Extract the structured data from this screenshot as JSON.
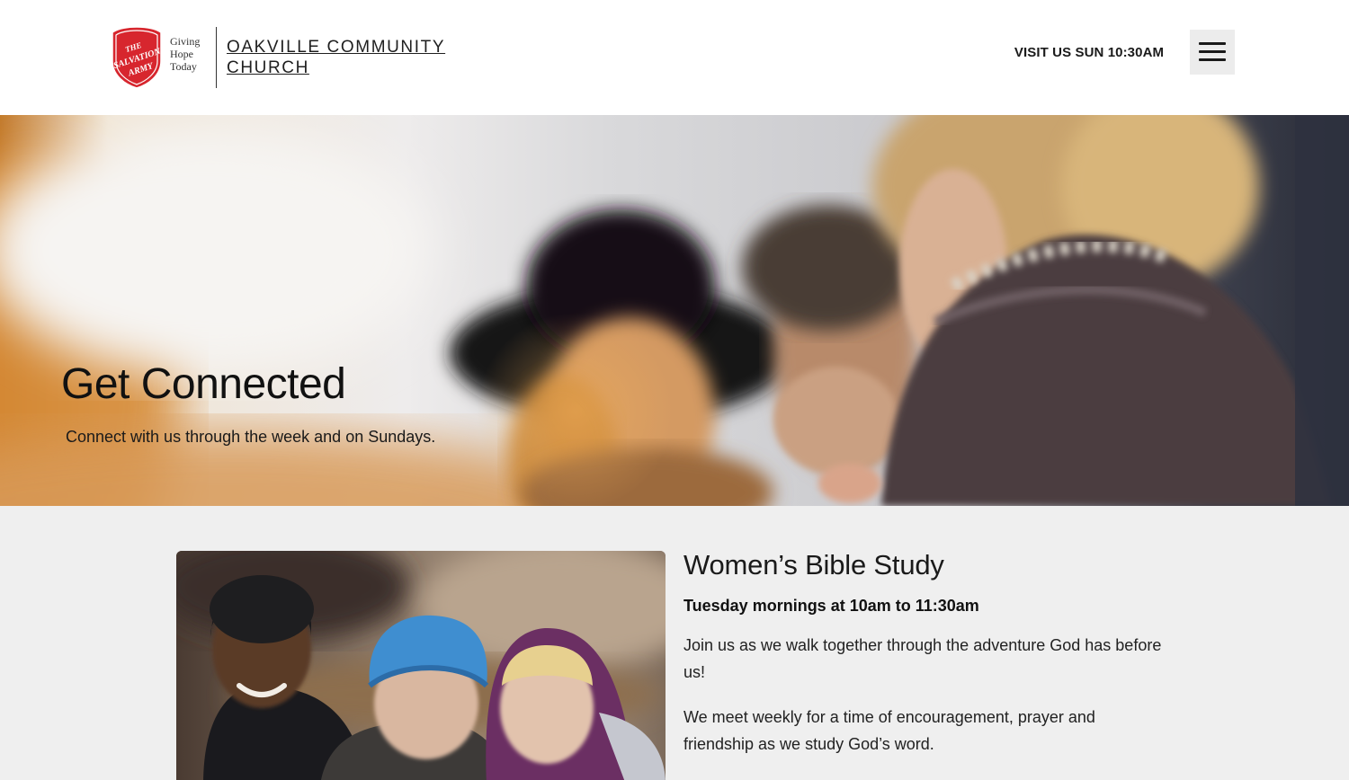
{
  "header": {
    "logo_text": "THE SALVATION ARMY",
    "tagline": [
      "Giving",
      "Hope",
      "Today"
    ],
    "church_name": [
      "OAKVILLE COMMUNITY",
      "CHURCH"
    ],
    "visit_link": "VISIT US SUN 10:30AM",
    "menu_icon": "hamburger-menu-icon"
  },
  "hero": {
    "title": "Get Connected",
    "subtitle": "Connect with us through the week and on Sundays."
  },
  "ministry": {
    "title": "Women’s Bible Study",
    "schedule": "Tuesday mornings at 10am to 11:30am",
    "paragraph1": "Join us as we walk together through the adventure God has before us!",
    "paragraph2": "We meet weekly for a time of encouragement, prayer and friendship as we study God’s word."
  },
  "colors": {
    "shield_red": "#d7262e",
    "header_bg": "#ffffff",
    "section_bg": "#efefef",
    "text": "#1a1a1a"
  }
}
